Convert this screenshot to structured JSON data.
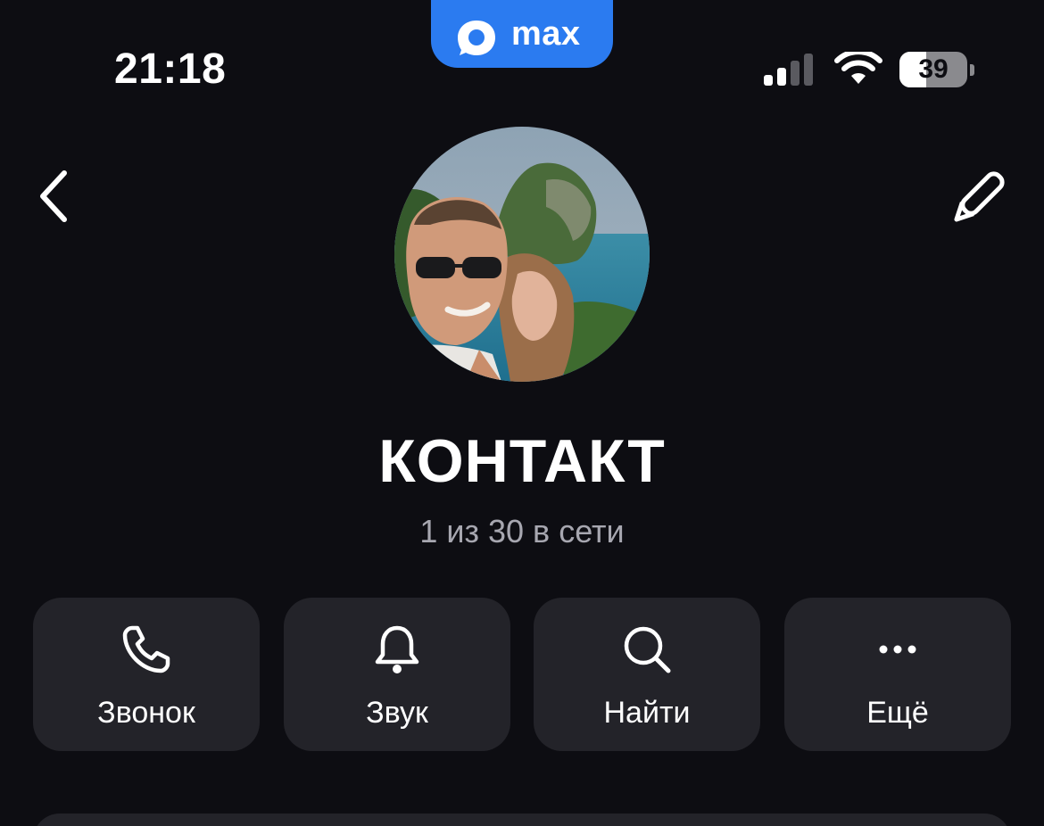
{
  "status_bar": {
    "time": "21:18",
    "app_badge": "max",
    "battery_level": "39",
    "battery_fraction": 0.39
  },
  "header": {
    "back_icon": "chevron-left-icon",
    "edit_icon": "pencil-icon"
  },
  "profile": {
    "name": "КОНТАКТ",
    "status": "1 из 30 в сети"
  },
  "actions": [
    {
      "label": "Звонок",
      "icon": "phone-icon"
    },
    {
      "label": "Звук",
      "icon": "bell-icon"
    },
    {
      "label": "Найти",
      "icon": "search-icon"
    },
    {
      "label": "Ещё",
      "icon": "more-icon"
    }
  ],
  "colors": {
    "background": "#0d0d12",
    "card": "#232329",
    "accent": "#2b7bf0",
    "secondary_text": "#a7a7b0"
  }
}
